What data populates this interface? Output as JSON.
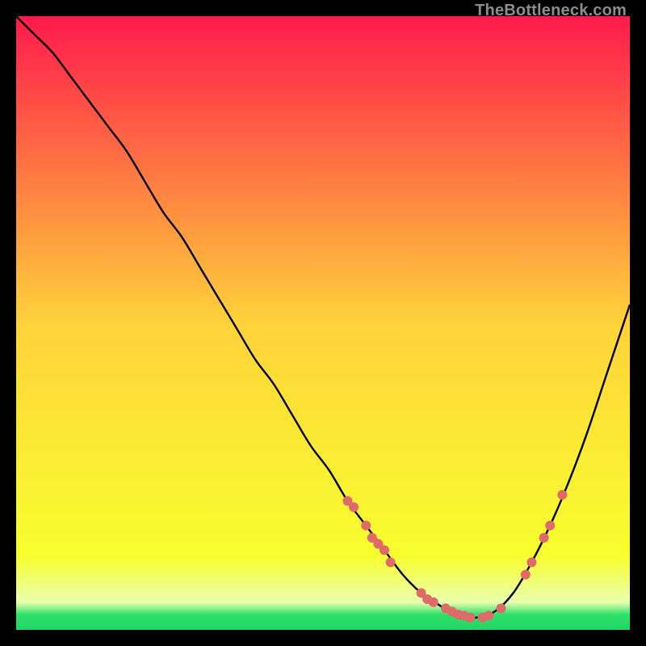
{
  "watermark": "TheBottleneck.com",
  "chart_data": {
    "type": "line",
    "title": "",
    "xlabel": "",
    "ylabel": "",
    "xlim": [
      0,
      100
    ],
    "ylim": [
      0,
      100
    ],
    "grid": false,
    "legend": false,
    "gradient_stops": [
      {
        "pos": 0.0,
        "color": "#ff1a4b"
      },
      {
        "pos": 0.5,
        "color": "#ffd23a"
      },
      {
        "pos": 0.88,
        "color": "#f7ff2e"
      },
      {
        "pos": 0.955,
        "color": "#eaffae"
      },
      {
        "pos": 0.975,
        "color": "#2fe06a"
      },
      {
        "pos": 1.0,
        "color": "#22d565"
      }
    ],
    "series": [
      {
        "name": "bottleneck-curve",
        "color": "#000000",
        "x": [
          0,
          3,
          6,
          9,
          12,
          15,
          18,
          21,
          24,
          27,
          30,
          33,
          36,
          39,
          42,
          45,
          48,
          51,
          54,
          57,
          60,
          63,
          66,
          69,
          72,
          75,
          78,
          81,
          84,
          87,
          90,
          93,
          96,
          100
        ],
        "y": [
          100,
          97,
          94,
          90,
          86,
          82,
          78,
          73,
          68,
          64,
          59,
          54,
          49,
          44,
          40,
          35,
          30,
          26,
          21,
          17,
          13,
          9,
          6,
          4,
          2,
          2,
          3,
          6,
          11,
          17,
          24,
          32,
          41,
          53
        ]
      }
    ],
    "markers": {
      "name": "data-points",
      "color": "#e06a6a",
      "radius": 6,
      "points": [
        {
          "x": 54,
          "y": 21
        },
        {
          "x": 55,
          "y": 20
        },
        {
          "x": 57,
          "y": 17
        },
        {
          "x": 58,
          "y": 15
        },
        {
          "x": 59,
          "y": 14
        },
        {
          "x": 60,
          "y": 13
        },
        {
          "x": 61,
          "y": 11
        },
        {
          "x": 66,
          "y": 6
        },
        {
          "x": 67,
          "y": 5
        },
        {
          "x": 68,
          "y": 4.5
        },
        {
          "x": 70,
          "y": 3.5
        },
        {
          "x": 71,
          "y": 3
        },
        {
          "x": 72,
          "y": 2.5
        },
        {
          "x": 73,
          "y": 2.3
        },
        {
          "x": 74,
          "y": 2
        },
        {
          "x": 76,
          "y": 2
        },
        {
          "x": 77,
          "y": 2.3
        },
        {
          "x": 79,
          "y": 3.5
        },
        {
          "x": 83,
          "y": 9
        },
        {
          "x": 84,
          "y": 11
        },
        {
          "x": 86,
          "y": 15
        },
        {
          "x": 87,
          "y": 17
        },
        {
          "x": 89,
          "y": 22
        }
      ]
    }
  }
}
